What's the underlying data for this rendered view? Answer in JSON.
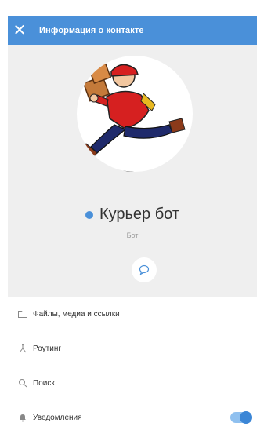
{
  "header": {
    "title": "Информация о контакте",
    "close_icon": "close-icon"
  },
  "profile": {
    "name": "Курьер бот",
    "subtitle": "Бот",
    "status_color": "#4a90d9",
    "message_icon": "chat-bubble-icon"
  },
  "menu": [
    {
      "label": "Файлы, медиа и ссылки",
      "icon": "folder-icon"
    },
    {
      "label": "Роутинг",
      "icon": "routing-icon"
    },
    {
      "label": "Поиск",
      "icon": "search-icon"
    },
    {
      "label": "Уведомления",
      "icon": "bell-icon",
      "toggle_on": true
    }
  ],
  "colors": {
    "accent": "#4a90d9",
    "header_bg": "#4a90d9",
    "profile_bg": "#efefef"
  }
}
